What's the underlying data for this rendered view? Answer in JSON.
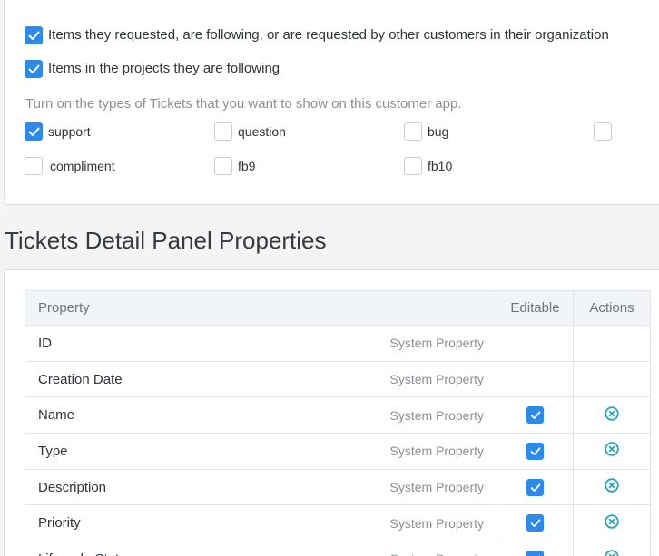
{
  "visibility_options": [
    {
      "label": "Items they requested, are following, or are requested by other customers in their organization",
      "checked": true
    },
    {
      "label": "Items in the projects they are following",
      "checked": true
    }
  ],
  "ticket_types_hint": "Turn on the types of Tickets that you want to show on this customer app.",
  "ticket_types": [
    {
      "label": "support",
      "checked": true
    },
    {
      "label": "question",
      "checked": false
    },
    {
      "label": "bug",
      "checked": false
    },
    {
      "label": "",
      "checked": false
    },
    {
      "label": "compliment",
      "checked": false
    },
    {
      "label": "fb9",
      "checked": false
    },
    {
      "label": "fb10",
      "checked": false
    }
  ],
  "section_title": "Tickets Detail Panel Properties",
  "table": {
    "headers": {
      "property": "Property",
      "editable": "Editable",
      "actions": "Actions"
    },
    "rows": [
      {
        "name": "ID",
        "kind": "System Property",
        "editable": null,
        "removable": false
      },
      {
        "name": "Creation Date",
        "kind": "System Property",
        "editable": null,
        "removable": false
      },
      {
        "name": "Name",
        "kind": "System Property",
        "editable": true,
        "removable": true
      },
      {
        "name": "Type",
        "kind": "System Property",
        "editable": true,
        "removable": true
      },
      {
        "name": "Description",
        "kind": "System Property",
        "editable": true,
        "removable": true
      },
      {
        "name": "Priority",
        "kind": "System Property",
        "editable": true,
        "removable": true
      },
      {
        "name": "Lifecycle State",
        "kind": "System Property",
        "editable": true,
        "removable": true
      }
    ]
  },
  "colors": {
    "accent": "#2d8ae8",
    "remove_icon": "#2ba3b8"
  }
}
